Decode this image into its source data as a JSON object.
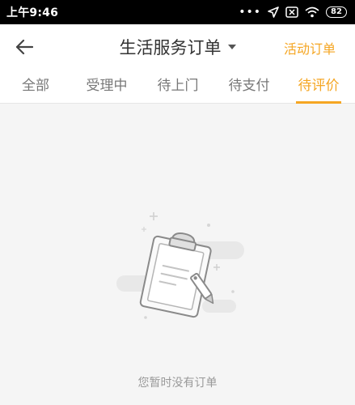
{
  "status_bar": {
    "time": "上午9:46",
    "battery": "82",
    "icons": [
      "more-dots-icon",
      "location-arrow-icon",
      "sim-off-icon",
      "wifi-icon",
      "battery-icon"
    ]
  },
  "header": {
    "title": "生活服务订单",
    "action": "活动订单",
    "back_icon": "back-arrow-icon",
    "dropdown_icon": "caret-down-icon"
  },
  "tabs": [
    {
      "label": "全部",
      "active": false
    },
    {
      "label": "受理中",
      "active": false
    },
    {
      "label": "待上门",
      "active": false
    },
    {
      "label": "待支付",
      "active": false
    },
    {
      "label": "待评价",
      "active": true
    }
  ],
  "empty_state": {
    "message": "您暂时没有订单",
    "icon": "clipboard-empty-icon"
  },
  "colors": {
    "accent": "#f5a623",
    "title": "#333333",
    "tab_inactive": "#777777",
    "background": "#f5f5f5",
    "status_bar": "#000000"
  }
}
